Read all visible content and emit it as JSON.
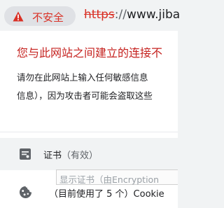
{
  "address_bar": {
    "security_label": "不安全",
    "url_scheme": "https",
    "url_separator": "://",
    "url_host": "www.jiba"
  },
  "site_info": {
    "warning_title": "您与此网站之间建立的连接不",
    "warning_line1": "请勿在此网站上输入任何敏感信息",
    "warning_line2": "信息），因为攻击者可能会盗取这些",
    "certificate": {
      "label": "证书",
      "status": "（有效）",
      "tooltip": "显示证书（由Encryption"
    },
    "cookies": {
      "label": "（目前使用了 5 个）Cookie"
    }
  },
  "colors": {
    "insecure": "#d93025",
    "warning_title": "#c5221f"
  }
}
